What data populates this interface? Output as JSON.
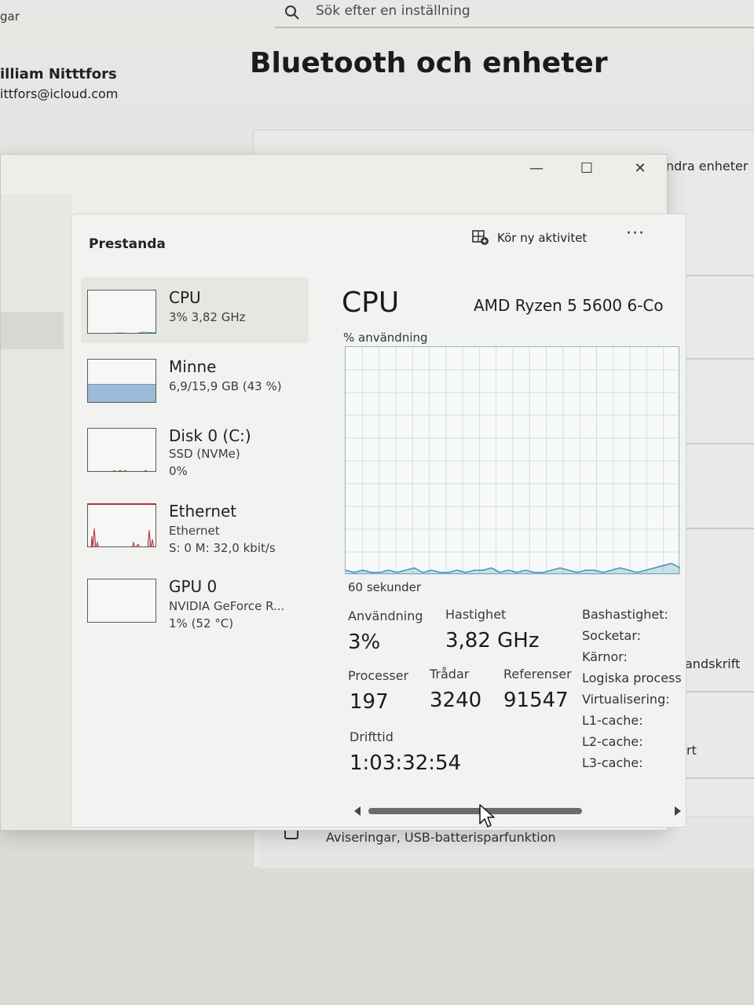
{
  "background": {
    "crumb": "gar",
    "search_placeholder": "Sök efter en inställning",
    "user_name": "illiam Nitttfors",
    "user_email": "ittfors@icloud.com",
    "page_title": "Bluetooth och enheter",
    "right_texts": [
      "ndra enheter",
      "andskrift",
      "rt"
    ],
    "bottom_row_text": "Aviseringar, USB-batterisparfunktion"
  },
  "window": {
    "minimize": "—",
    "maximize": "☐",
    "close": "✕"
  },
  "taskmanager": {
    "section_title": "Prestanda",
    "run_new_task": "Kör ny aktivitet",
    "more": "···",
    "sidebar": [
      {
        "name": "CPU",
        "sub1": "3% 3,82 GHz",
        "sub2": ""
      },
      {
        "name": "Minne",
        "sub1": "6,9/15,9 GB (43 %)",
        "sub2": ""
      },
      {
        "name": "Disk 0 (C:)",
        "sub1": "SSD (NVMe)",
        "sub2": "0%"
      },
      {
        "name": "Ethernet",
        "sub1": "Ethernet",
        "sub2": "S: 0 M: 32,0 kbit/s"
      },
      {
        "name": "GPU 0",
        "sub1": "NVIDIA GeForce R...",
        "sub2": "1% (52 °C)"
      }
    ],
    "detail": {
      "title": "CPU",
      "model": "AMD Ryzen 5 5600 6-Co",
      "usage_axis_label": "% användning",
      "time_label": "60 sekunder",
      "stats": {
        "usage_label": "Användning",
        "usage_value": "3%",
        "speed_label": "Hastighet",
        "speed_value": "3,82 GHz",
        "processes_label": "Processer",
        "processes_value": "197",
        "threads_label": "Trådar",
        "threads_value": "3240",
        "handles_label": "Referenser",
        "handles_value": "91547",
        "uptime_label": "Drifttid",
        "uptime_value": "1:03:32:54"
      },
      "specs": [
        "Bashastighet:",
        "Socketar:",
        "Kärnor:",
        "Logiska process",
        "Virtualisering:",
        "L1-cache:",
        "L2-cache:",
        "L3-cache:"
      ]
    },
    "colors": {
      "cpu_line": "#3f90b8",
      "memory_fill": "#9bbbd9",
      "ethernet_line": "#b03040",
      "grid": "#cfe0d8"
    },
    "cpu_usage_history_percent": [
      2,
      1,
      2,
      1,
      1,
      2,
      1,
      2,
      3,
      1,
      2,
      1,
      1,
      2,
      1,
      2,
      2,
      3,
      1,
      2,
      1,
      2,
      1,
      1,
      2,
      3,
      2,
      1,
      2,
      2,
      1,
      2,
      3,
      2,
      1,
      2,
      3,
      4,
      5,
      3
    ],
    "memory_usage_percent": 43
  }
}
